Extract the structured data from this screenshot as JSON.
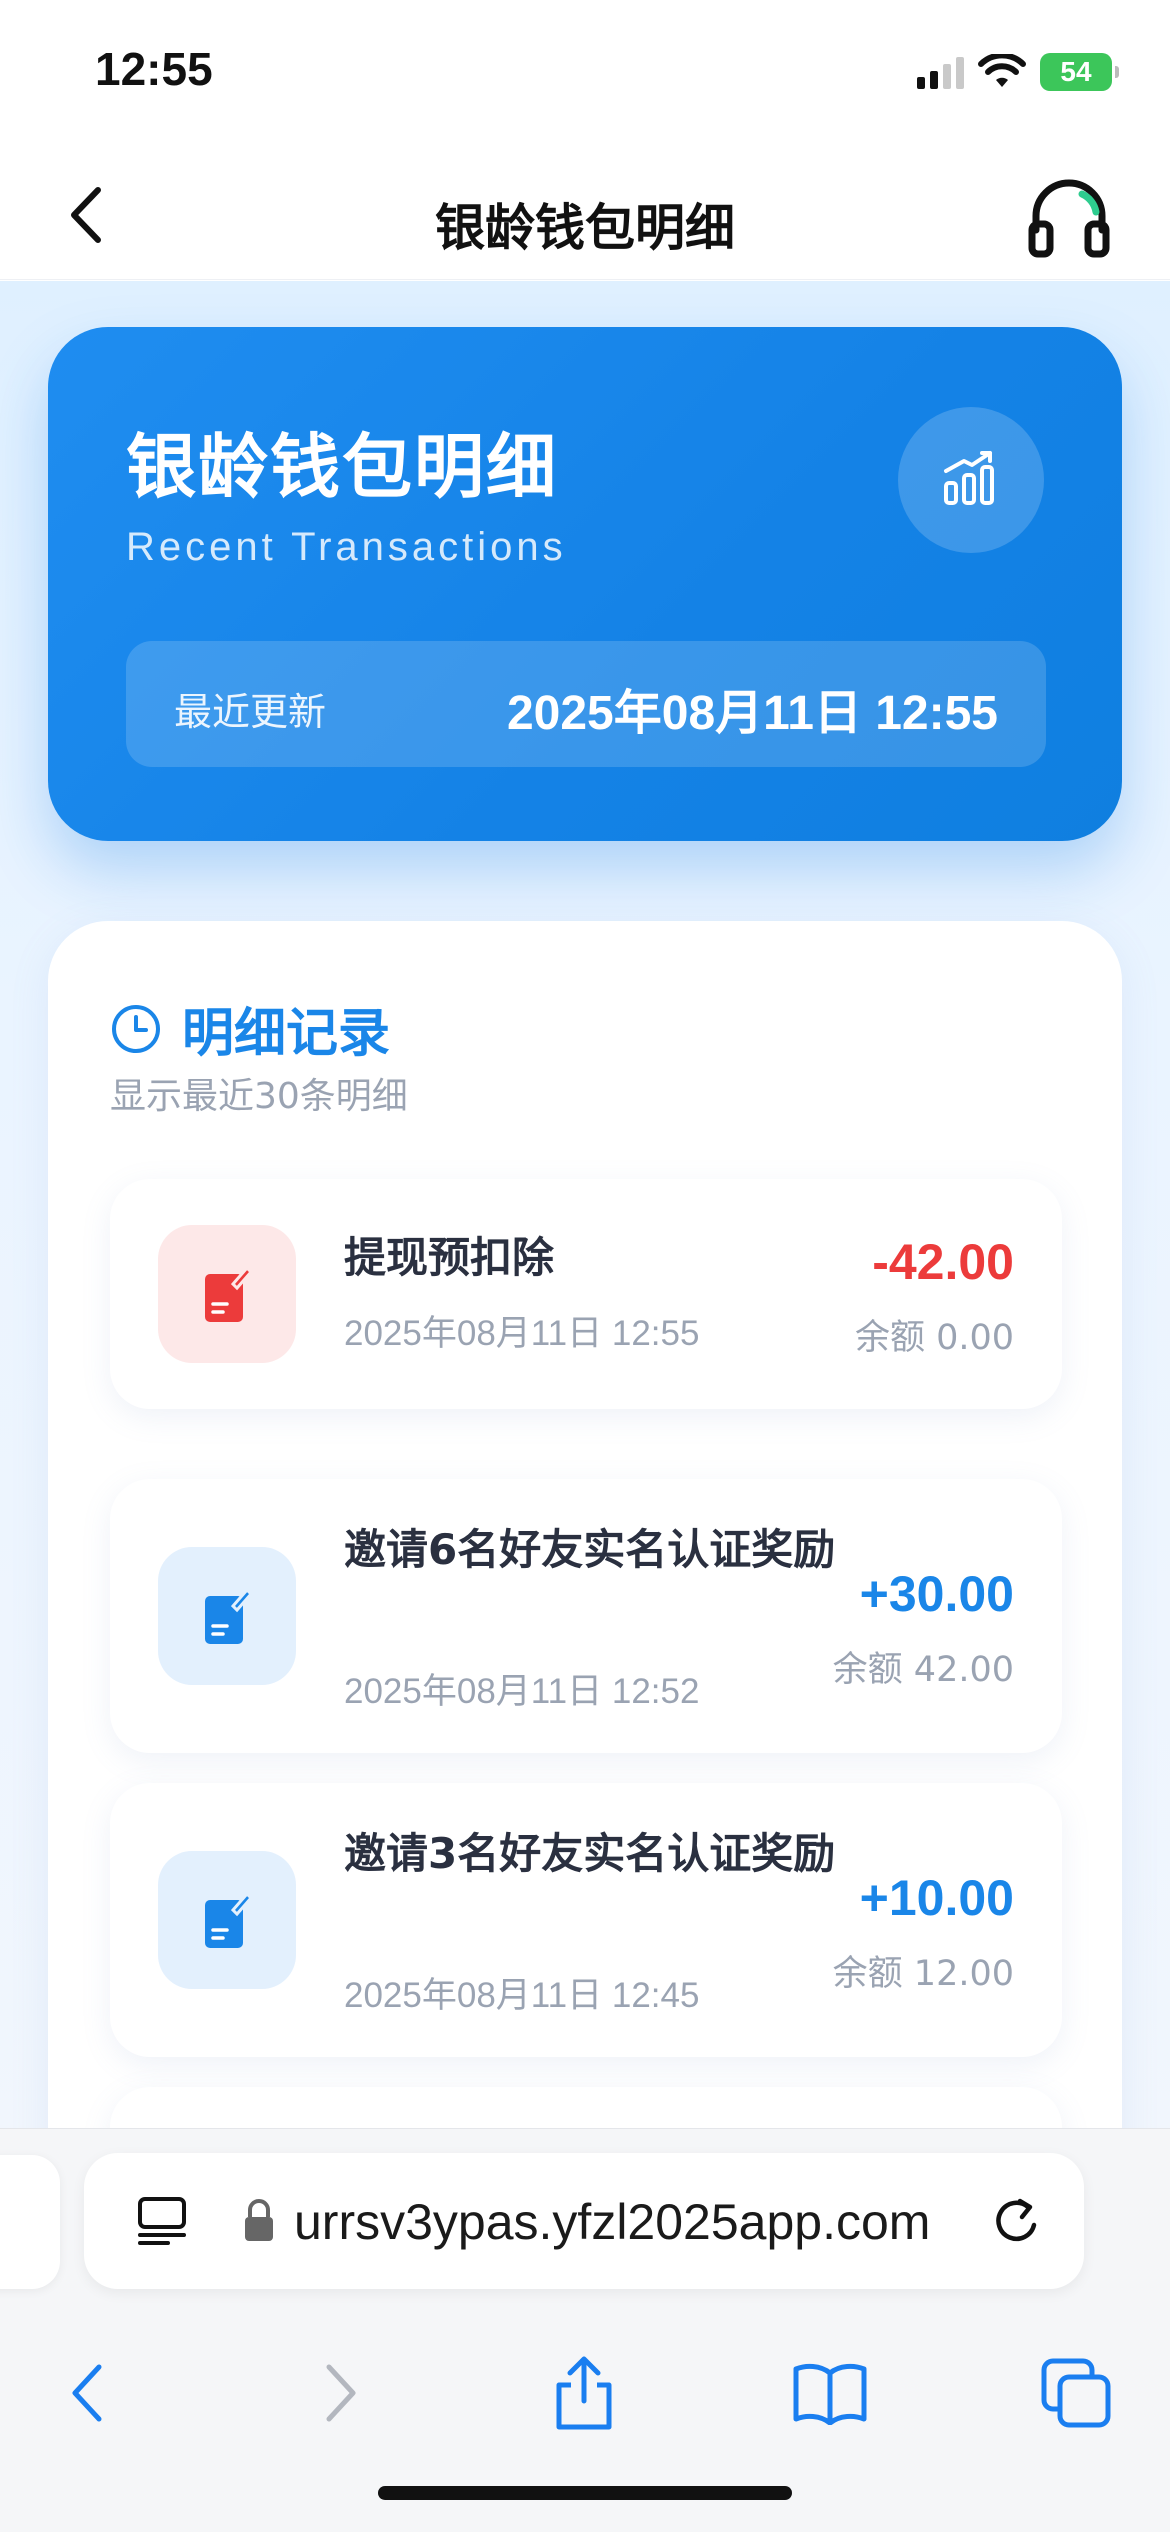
{
  "status_bar": {
    "time": "12:55",
    "battery": "54"
  },
  "nav": {
    "title": "银龄钱包明细",
    "back_icon": "chevron-left-icon",
    "support_icon": "headset-icon"
  },
  "hero": {
    "title": "银龄钱包明细",
    "subtitle": "Recent Transactions",
    "chart_icon": "bar-chart-trend-icon",
    "update_label": "最近更新",
    "update_value": "2025年08月11日 12:55"
  },
  "records": {
    "title": "明细记录",
    "clock_icon": "clock-icon",
    "subtitle": "显示最近30条明细",
    "items": [
      {
        "title": "提现预扣除",
        "time": "2025年08月11日 12:55",
        "amount": "-42.00",
        "balance": "余额 0.00",
        "type": "debit",
        "color": "#ec3b3b"
      },
      {
        "title": "邀请6名好友实名认证奖励",
        "time": "2025年08月11日 12:52",
        "amount": "+30.00",
        "balance": "余额 42.00",
        "type": "credit",
        "color": "#1a86e8"
      },
      {
        "title": "邀请3名好友实名认证奖励",
        "time": "2025年08月11日 12:45",
        "amount": "+10.00",
        "balance": "余额 12.00",
        "type": "credit",
        "color": "#1a86e8"
      }
    ]
  },
  "browser": {
    "url": "urrsv3ypas.yfzl2025app.com",
    "icons": [
      "reader-icon",
      "lock-icon",
      "reload-icon",
      "back-arrow-icon",
      "forward-arrow-icon",
      "share-icon",
      "bookmarks-icon",
      "tabs-icon"
    ]
  },
  "colors": {
    "accent": "#1a86e8",
    "negative": "#ec3b3b",
    "hero_bg": "#1482e6"
  }
}
